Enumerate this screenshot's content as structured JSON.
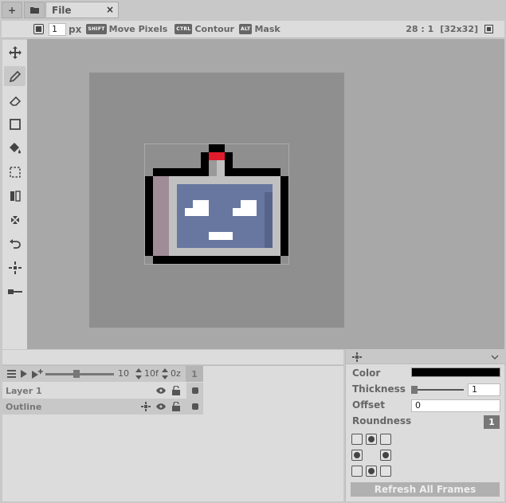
{
  "tabs": {
    "add_label": "+",
    "file_label": "File",
    "close_label": "×"
  },
  "options": {
    "brush_size": "1",
    "brush_unit": "px",
    "shift_key": "SHIFT",
    "shift_label": "Move Pixels",
    "ctrl_key": "CTRL",
    "ctrl_label": "Contour",
    "alt_key": "ALT",
    "alt_label": "Mask",
    "zoom_text": "28 : 1",
    "size_text": "[32x32]"
  },
  "tools": [
    "move-tool",
    "pencil-tool",
    "eraser-tool",
    "rectangle-tool",
    "fill-tool",
    "selection-tool",
    "mirror-tool",
    "shift-tool",
    "undo-tool",
    "symmetry-tool",
    "line-tool"
  ],
  "timeline": {
    "fps": "10",
    "frame_count": "10f",
    "onion": "0z",
    "current_frame": "1",
    "slider_level": 0.45,
    "layers": [
      {
        "name": "Layer 1"
      },
      {
        "name": "Outline"
      }
    ]
  },
  "properties": {
    "color_label": "Color",
    "color_value": "#000000",
    "thickness_label": "Thickness",
    "thickness_value": "1",
    "offset_label": "Offset",
    "offset_value": "0",
    "roundness_label": "Roundness",
    "roundness_value": "1",
    "refresh_label": "Refresh All Frames"
  },
  "colors": {
    "outline": "#000000",
    "body_light": "#c0c0c0",
    "body_pink": "#a08c96",
    "screen": "#6777a0",
    "screen_dark": "#56648c",
    "eyes": "#ffffff",
    "antenna_red": "#e01c2c",
    "antenna_grey": "#9a9a9a"
  }
}
